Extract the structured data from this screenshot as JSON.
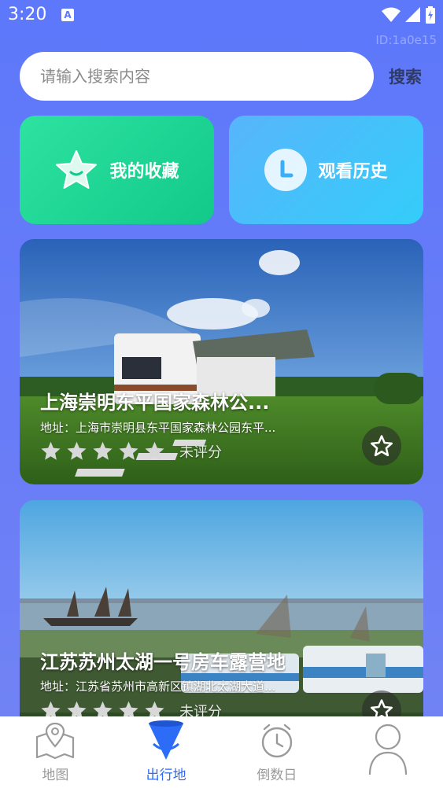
{
  "status_bar": {
    "time": "3:20",
    "notification_badge": "A"
  },
  "device_id": "ID:1a0e15",
  "search": {
    "placeholder": "请输入搜索内容",
    "value": "",
    "button_label": "搜索"
  },
  "quick_actions": [
    {
      "label": "我的收藏",
      "icon": "star-icon",
      "color": "#12c98a"
    },
    {
      "label": "观看历史",
      "icon": "clock-icon",
      "color": "#33cdf9"
    }
  ],
  "places": [
    {
      "title": "上海崇明东平国家森林公...",
      "address": "地址：上海市崇明县东平国家森林公园东平...",
      "rating_text": "未评分",
      "stars": 0
    },
    {
      "title": "江苏苏州太湖一号房车露营地",
      "address": "地址：江苏省苏州市高新区镇湖北太湖大道...",
      "rating_text": "未评分",
      "stars": 0
    }
  ],
  "bottom_nav": [
    {
      "label": "地图",
      "icon": "map-icon",
      "active": false
    },
    {
      "label": "出行地",
      "icon": "location-pin-icon",
      "active": true
    },
    {
      "label": "倒数日",
      "icon": "alarm-clock-icon",
      "active": false
    },
    {
      "label": "",
      "icon": "profile-icon",
      "active": false
    }
  ],
  "colors": {
    "background": "#5d78fb",
    "active_nav": "#2c6cf6",
    "inactive_nav": "#9a9a9a"
  }
}
